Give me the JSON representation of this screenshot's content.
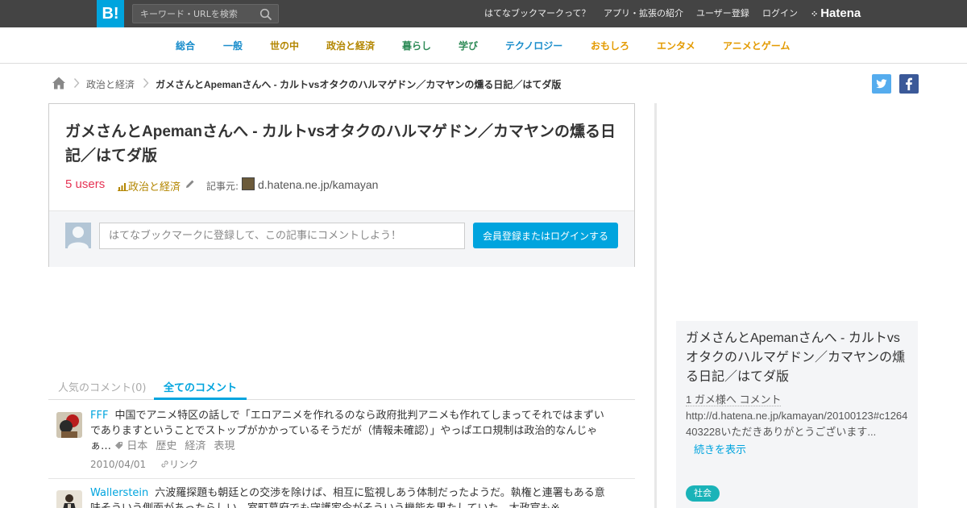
{
  "header": {
    "logo": "B!",
    "search_placeholder": "キーワード・URLを検索",
    "nav": [
      "はてなブックマークって？",
      "アプリ・拡張の紹介",
      "ユーザー登録",
      "ログイン"
    ],
    "brand": "Hatena"
  },
  "categories": [
    {
      "label": "総合",
      "color": "#1a8dcb"
    },
    {
      "label": "一般",
      "color": "#1a8dcb"
    },
    {
      "label": "世の中",
      "color": "#b38600"
    },
    {
      "label": "政治と経済",
      "color": "#b38600"
    },
    {
      "label": "暮らし",
      "color": "#2e8b57"
    },
    {
      "label": "学び",
      "color": "#2e8b57"
    },
    {
      "label": "テクノロジー",
      "color": "#1a8dcb"
    },
    {
      "label": "おもしろ",
      "color": "#e39a00"
    },
    {
      "label": "エンタメ",
      "color": "#e39a00"
    },
    {
      "label": "アニメとゲーム",
      "color": "#e39a00"
    }
  ],
  "breadcrumb": {
    "category": "政治と経済",
    "current": "ガメさんとApemanさんへ - カルトvsオタクのハルマゲドン／カマヤンの燻る日記／はてダ版"
  },
  "entry": {
    "title": "ガメさんとApemanさんへ - カルトvsオタクのハルマゲドン／カマヤンの燻る日記／はてダ版",
    "users": "5 users",
    "category": "政治と経済",
    "source_label": "記事元:",
    "source_url": "d.hatena.ne.jp/kamayan",
    "comment_placeholder": "はてなブックマークに登録して、この記事にコメントしよう！",
    "login_button": "会員登録またはログインする"
  },
  "tabs": {
    "popular": "人気のコメント(0)",
    "all": "全てのコメント"
  },
  "comments": [
    {
      "user": "FFF",
      "text": "中国でアニメ特区の話しで「エロアニメを作れるのなら政府批判アニメも作れてしまってそれではまずいでありますということでストップがかかっているそうだが（情報未確認）」やっぱエロ規制は政治的なんじゃぁ…",
      "tags": [
        "日本",
        "歴史",
        "経済",
        "表現"
      ],
      "date": "2010/04/01",
      "link": "リンク"
    },
    {
      "user": "Wallerstein",
      "text": "六波羅探題も朝廷との交渉を除けば、相互に監視しあう体制だったようだ。執権と連署もある意味そういう側面があったらしい。室町幕府でも守護家令がそういう機能を果たしていた。大政官も※",
      "tags": [],
      "date": "",
      "link": ""
    }
  ],
  "sidebar": {
    "title": "ガメさんとApemanさんへ - カルトvsオタクのハルマゲドン／カマヤンの燻る日記／はてダ版",
    "count_text": "1 ガメ様へ コメント",
    "excerpt": "http://d.hatena.ne.jp/kamayan/20100123#c1264403228いただきありがとうございます...",
    "more": "続きを表示",
    "badge": "社会"
  }
}
